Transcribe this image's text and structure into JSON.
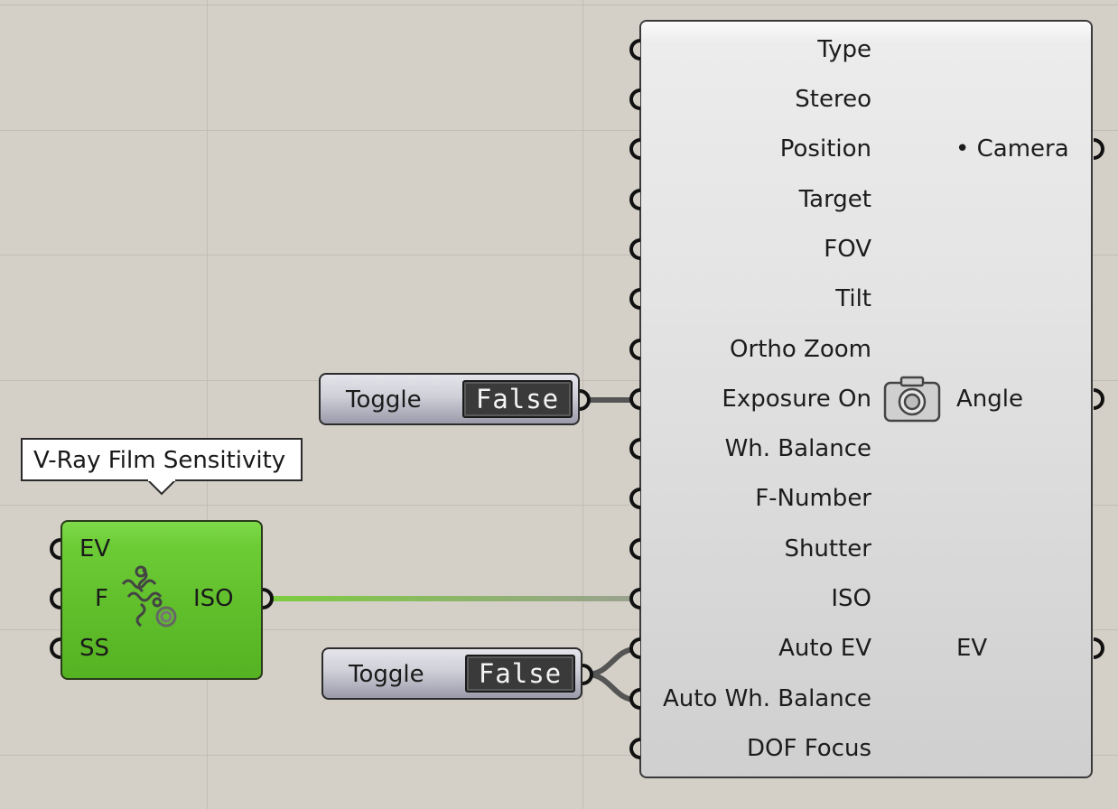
{
  "camera_component": {
    "inputs": [
      {
        "name": "Type"
      },
      {
        "name": "Stereo"
      },
      {
        "name": "Position"
      },
      {
        "name": "Target"
      },
      {
        "name": "FOV"
      },
      {
        "name": "Tilt"
      },
      {
        "name": "Ortho Zoom"
      },
      {
        "name": "Exposure On"
      },
      {
        "name": "Wh. Balance"
      },
      {
        "name": "F-Number"
      },
      {
        "name": "Shutter"
      },
      {
        "name": "ISO"
      },
      {
        "name": "Auto EV"
      },
      {
        "name": "Auto Wh. Balance"
      },
      {
        "name": "DOF Focus"
      }
    ],
    "outputs": [
      {
        "name": "• Camera"
      },
      {
        "name": "Angle"
      },
      {
        "name": "EV"
      }
    ],
    "icon": "camera-icon"
  },
  "toggle_1": {
    "label": "Toggle",
    "value": "False"
  },
  "toggle_2": {
    "label": "Toggle",
    "value": "False"
  },
  "film_sensitivity": {
    "tooltip": "V-Ray Film Sensitivity",
    "inputs": [
      {
        "name": "EV"
      },
      {
        "name": "F"
      },
      {
        "name": "SS"
      }
    ],
    "output": "ISO",
    "icon": "gears-icon"
  },
  "colors": {
    "canvas": "#d4d0c8",
    "component_green": "#62c02d",
    "wire_dark": "#555555",
    "wire_iso_start": "#7ccc3e",
    "wire_iso_end": "#9aa28e"
  }
}
